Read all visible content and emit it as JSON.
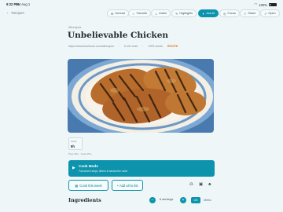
{
  "status": {
    "time": "9:22 PM",
    "date": "Sat Aug 1",
    "battery": "100%"
  },
  "toolbar": {
    "back_label": "Recipes",
    "unread": "Unread",
    "favorite": "Favorite",
    "listen": "Listen",
    "highlights": "Highlights",
    "ask_ai": "Ask AI",
    "focus": "Focus",
    "share": "Share",
    "open": "Open"
  },
  "article": {
    "breadcrumb": "Allrecipes",
    "title": "Unbelievable Chicken",
    "url": "https://www.facebook.com/allrecipes",
    "read_time": "6 min read",
    "word_count": "1393 words",
    "tag": "RECIPE"
  },
  "stat": {
    "label": "Setup",
    "value": "8h",
    "caption": "Prep 15m · Cook 15m"
  },
  "cook_mode": {
    "title": "Cook Mode",
    "subtitle": "Full-screen steps, timers & hands-free voice"
  },
  "actions": {
    "cook_this_week": "Cook this week",
    "add_to_list": "+ Add all to list"
  },
  "ingredients": {
    "title": "Ingredients",
    "servings": "6 servings",
    "units": [
      "US",
      "Metric"
    ],
    "selected_unit": "US"
  },
  "colors": {
    "accent": "#0e93ad",
    "tag": "#e07a2e",
    "background": "#eef6f8"
  }
}
